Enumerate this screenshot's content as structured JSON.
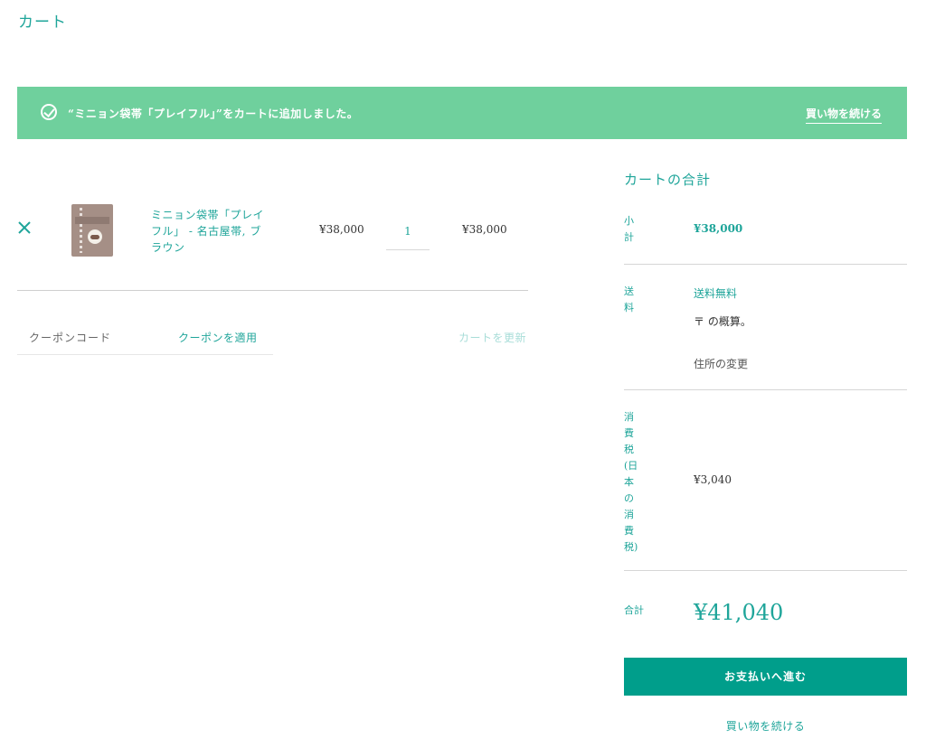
{
  "page": {
    "title": "カート"
  },
  "notice": {
    "message": "“ミニョン袋帯「プレイフル」”をカートに追加しました。",
    "continue_label": "買い物を続ける"
  },
  "cart": {
    "items": [
      {
        "name": "ミニョン袋帯「プレイフル」 - 名古屋帯, ブラウン",
        "price": "¥38,000",
        "quantity": "1",
        "subtotal": "¥38,000"
      }
    ],
    "coupon_placeholder": "クーポンコード",
    "apply_coupon_label": "クーポンを適用",
    "update_cart_label": "カートを更新"
  },
  "totals": {
    "title": "カートの合計",
    "subtotal_label": "小計",
    "subtotal_value": "¥38,000",
    "shipping_label": "送料",
    "shipping_value": "送料無料",
    "shipping_estimate": "〒 の概算。",
    "change_address_label": "住所の変更",
    "tax_label": "消費税(日本の消費税)",
    "tax_value": "¥3,040",
    "total_label": "合計",
    "total_value": "¥41,040",
    "checkout_label": "お支払いへ進む",
    "continue_label": "買い物を続ける"
  },
  "colors": {
    "accent": "#1fa59a",
    "notice_bg": "#6fd09d",
    "checkout_bg": "#009e8b"
  }
}
